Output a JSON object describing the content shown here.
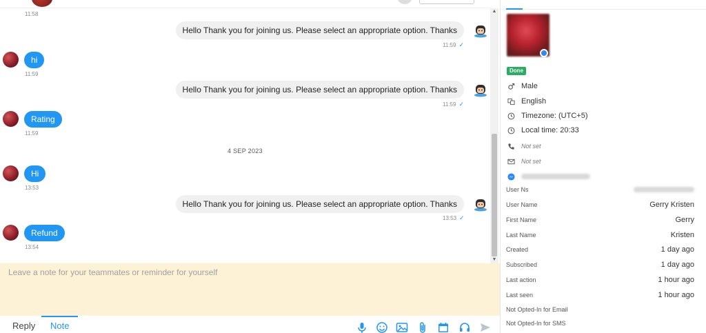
{
  "chat": {
    "first_timestamp": "11:58",
    "date_separator": "4 SEP 2023",
    "messages": [
      {
        "dir": "out",
        "text": "Hello Thank you for joining us. Please select an appropriate option. Thanks",
        "time": "11:59",
        "status": "✓"
      },
      {
        "dir": "in",
        "text": "hi",
        "time": "11:59"
      },
      {
        "dir": "out",
        "text": "Hello Thank you for joining us. Please select an appropriate option. Thanks",
        "time": "11:59",
        "status": "✓"
      },
      {
        "dir": "in",
        "text": "Rating",
        "time": "11:59"
      },
      {
        "dir": "in",
        "text": "Hi",
        "time": "13:53"
      },
      {
        "dir": "out",
        "text": "Hello Thank you for joining us. Please select an appropriate option. Thanks",
        "time": "13:53",
        "status": "✓"
      },
      {
        "dir": "in",
        "text": "Refund",
        "time": "13:54"
      }
    ]
  },
  "composer": {
    "note_placeholder": "Leave a note for your teammates or reminder for yourself",
    "tabs": {
      "reply": "Reply",
      "note": "Note"
    },
    "tools": [
      "microphone-icon",
      "emoji-icon",
      "image-icon",
      "attachment-icon",
      "calendar-icon",
      "headset-icon",
      "send-icon"
    ]
  },
  "profile": {
    "status_badge": "Done",
    "gender": "Male",
    "language": "English",
    "timezone": "Timezone: (UTC+5)",
    "local_time": "Local time: 20:33",
    "phone": "Not set",
    "email": "Not set",
    "attributes": [
      {
        "key": "User Ns",
        "value": ""
      },
      {
        "key": "User Name",
        "value": "Gerry Kristen"
      },
      {
        "key": "First Name",
        "value": "Gerry"
      },
      {
        "key": "Last Name",
        "value": "Kristen"
      },
      {
        "key": "Created",
        "value": "1 day ago"
      },
      {
        "key": "Subscribed",
        "value": "1 day ago"
      },
      {
        "key": "Last action",
        "value": "1 hour ago"
      },
      {
        "key": "Last seen",
        "value": "1 hour ago"
      },
      {
        "key": "Not Opted-In for Email",
        "value": ""
      },
      {
        "key": "Not Opted-In for SMS",
        "value": ""
      }
    ]
  },
  "colors": {
    "accent": "#2196f3",
    "done": "#27ae60",
    "note_bg": "#fdf1d6"
  }
}
